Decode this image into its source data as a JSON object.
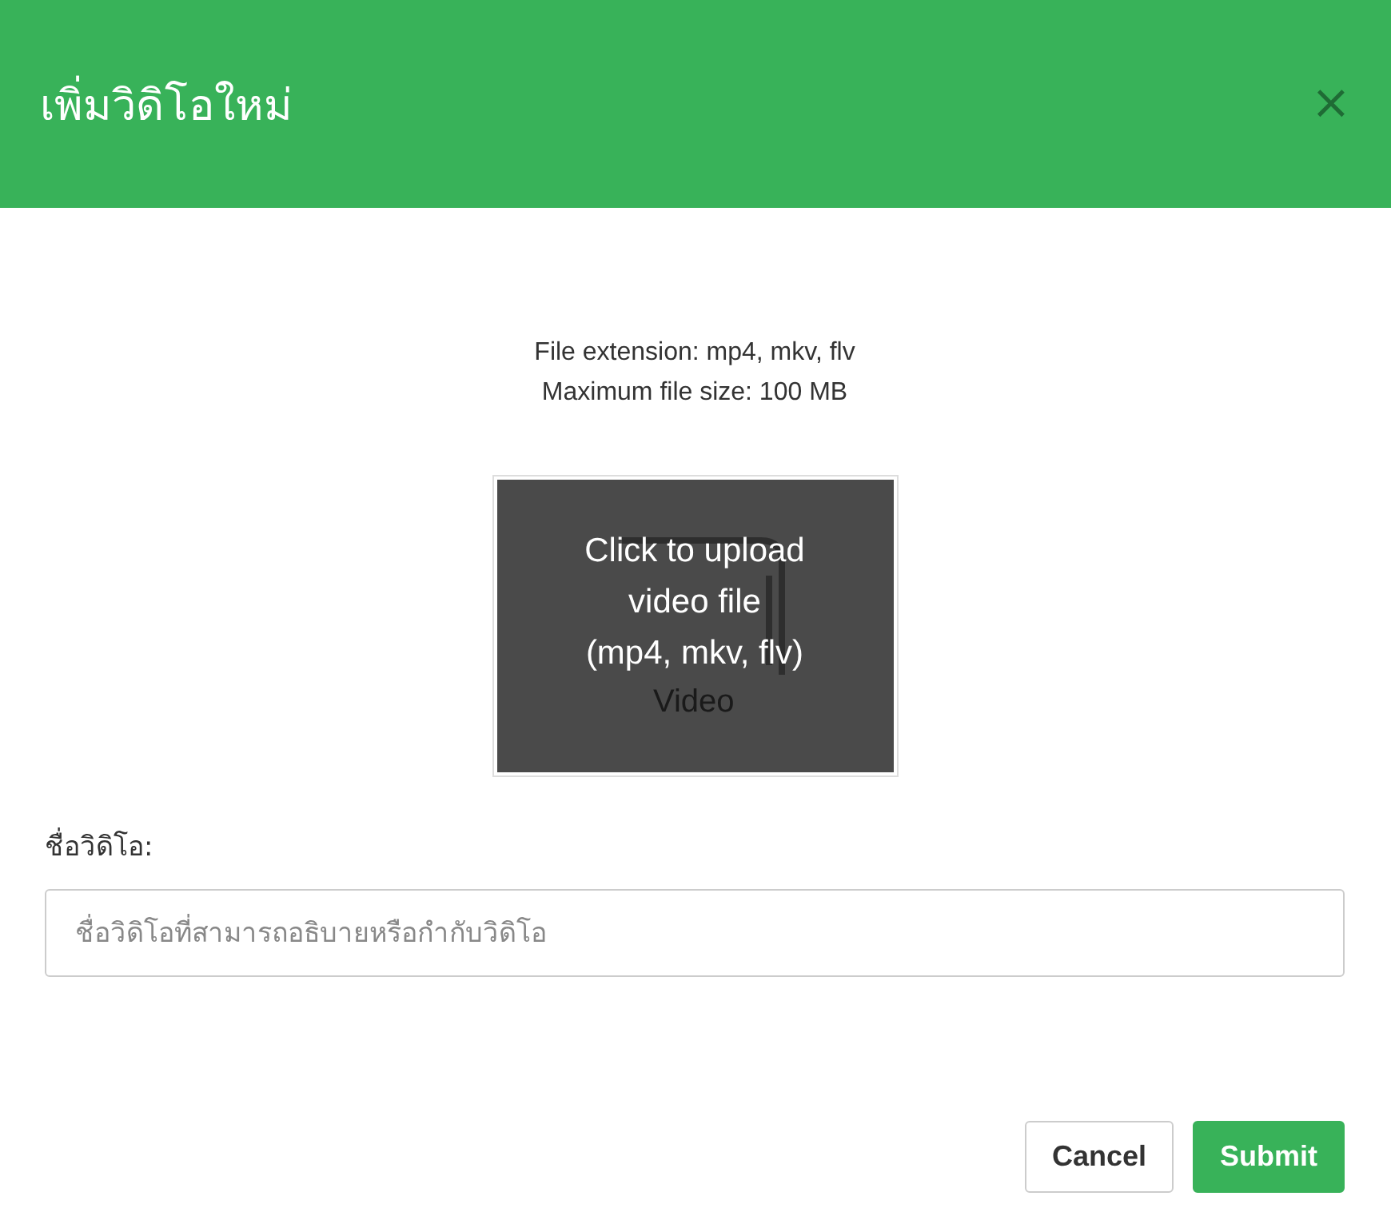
{
  "dialog": {
    "title": "เพิ่มวิดิโอใหม่",
    "close": "×"
  },
  "upload": {
    "info": [
      "File extension: mp4, mkv, flv",
      "Maximum file size: 100 MB"
    ],
    "logo_caption": "Video",
    "prompt": [
      "Click to upload",
      "video file",
      "(mp4, mkv, flv)"
    ]
  },
  "name_field": {
    "label": "ชื่อวิดิโอ:",
    "placeholder": "ชื่อวิดิโอที่สามารถอธิบายหรือกำกับวิดิโอ"
  },
  "buttons": [
    {
      "label": "Cancel",
      "kind": "secondary"
    },
    {
      "label": "Submit",
      "kind": "primary"
    }
  ]
}
